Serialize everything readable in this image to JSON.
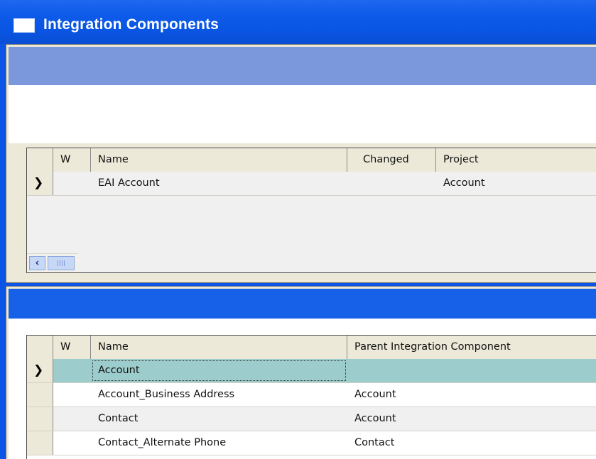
{
  "window": {
    "title": "Integration Components"
  },
  "top_grid": {
    "columns": [
      "W",
      "Name",
      "Changed",
      "Project"
    ],
    "rows": [
      {
        "selected": true,
        "w": "",
        "name": "EAI Account",
        "changed": "",
        "project": "Account"
      }
    ]
  },
  "bottom_grid": {
    "columns": [
      "W",
      "Name",
      "Parent Integration Component"
    ],
    "rows": [
      {
        "selected": true,
        "w": "",
        "name": "Account",
        "parent": ""
      },
      {
        "selected": false,
        "w": "",
        "name": "Account_Business Address",
        "parent": "Account"
      },
      {
        "selected": false,
        "w": "",
        "name": "Contact",
        "parent": "Account"
      },
      {
        "selected": false,
        "w": "",
        "name": "Contact_Alternate Phone",
        "parent": "Contact"
      }
    ]
  },
  "icons": {
    "window_icon": "window-icon",
    "row_indicator": "row-selected-arrow-icon",
    "scroll_left": "scroll-left-arrow-icon"
  },
  "colors": {
    "titlebar": "#0a55e6",
    "selected_row": "#9ccccc",
    "applet_header_top": "#7b98dc",
    "applet_header_bottom": "#1760e8"
  }
}
